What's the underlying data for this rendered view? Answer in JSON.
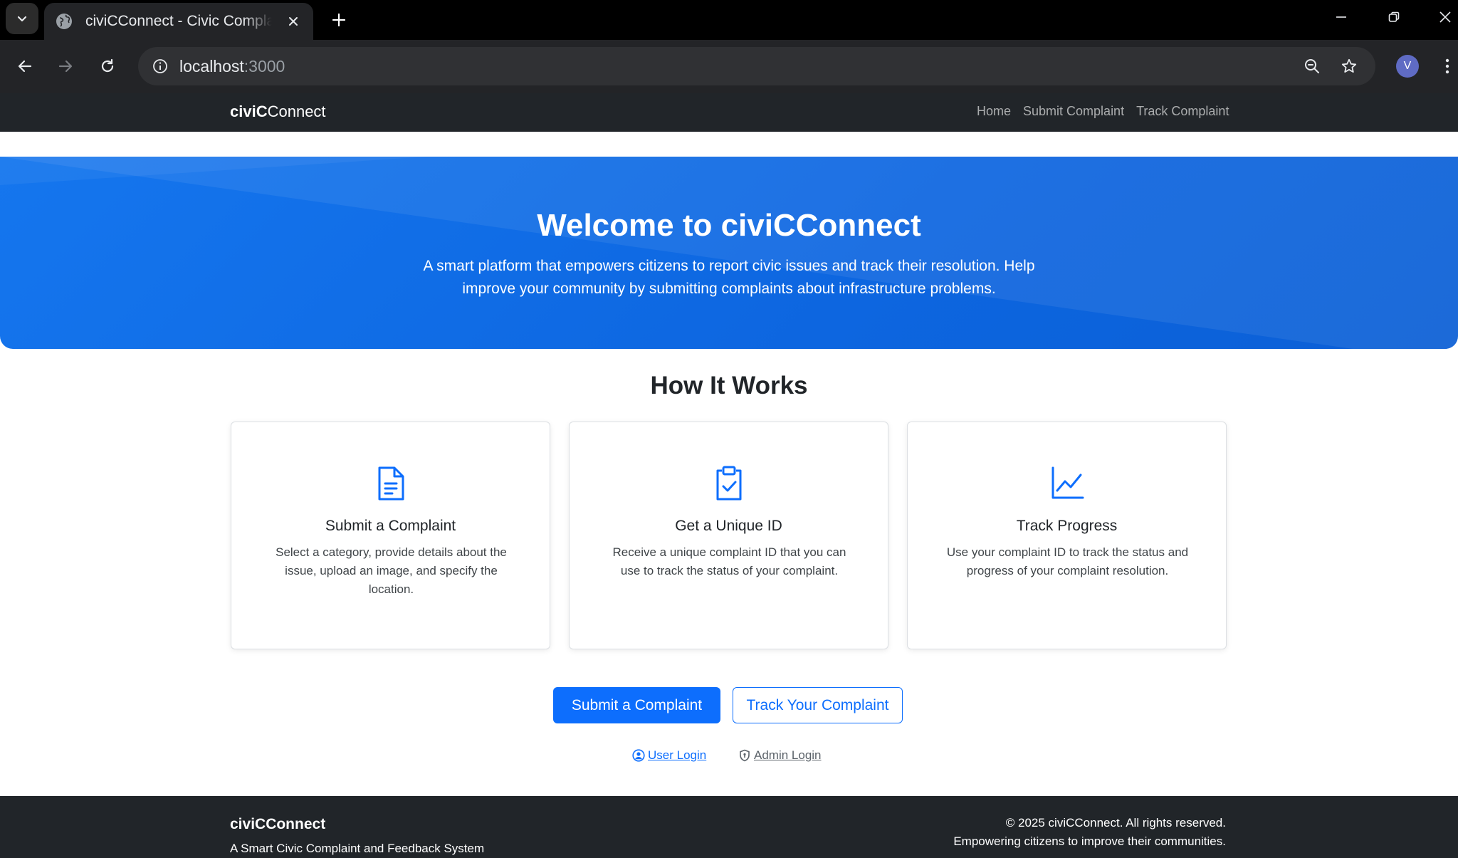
{
  "browser": {
    "tab_title": "civiCConnect - Civic Complaint",
    "url_host": "localhost",
    "url_port": ":3000",
    "profile_initial": "V"
  },
  "site": {
    "brand_bold": "civiC",
    "brand_rest": "Connect",
    "nav": [
      "Home",
      "Submit Complaint",
      "Track Complaint"
    ]
  },
  "hero": {
    "title": "Welcome to civiCConnect",
    "subtitle": "A smart platform that empowers citizens to report civic issues and track their resolution. Help improve your community by submitting complaints about infrastructure problems."
  },
  "how": {
    "title": "How It Works",
    "cards": [
      {
        "icon": "document-icon",
        "title": "Submit a Complaint",
        "text": "Select a category, provide details about the issue, upload an image, and specify the location."
      },
      {
        "icon": "clipboard-check-icon",
        "title": "Get a Unique ID",
        "text": "Receive a unique complaint ID that you can use to track the status of your complaint."
      },
      {
        "icon": "graph-up-icon",
        "title": "Track Progress",
        "text": "Use your complaint ID to track the status and progress of your complaint resolution."
      }
    ]
  },
  "cta": {
    "primary": "Submit a Complaint",
    "secondary": "Track Your Complaint",
    "user_login": "User Login",
    "admin_login": "Admin Login"
  },
  "footer": {
    "brand": "civiCConnect",
    "tagline": "A Smart Civic Complaint and Feedback System",
    "copyright": "© 2025 civiCConnect. All rights reserved.",
    "mission": "Empowering citizens to improve their communities."
  },
  "colors": {
    "primary": "#0d6efd",
    "dark": "#212529",
    "hero": "#1576ee",
    "chrome": "#232427"
  }
}
